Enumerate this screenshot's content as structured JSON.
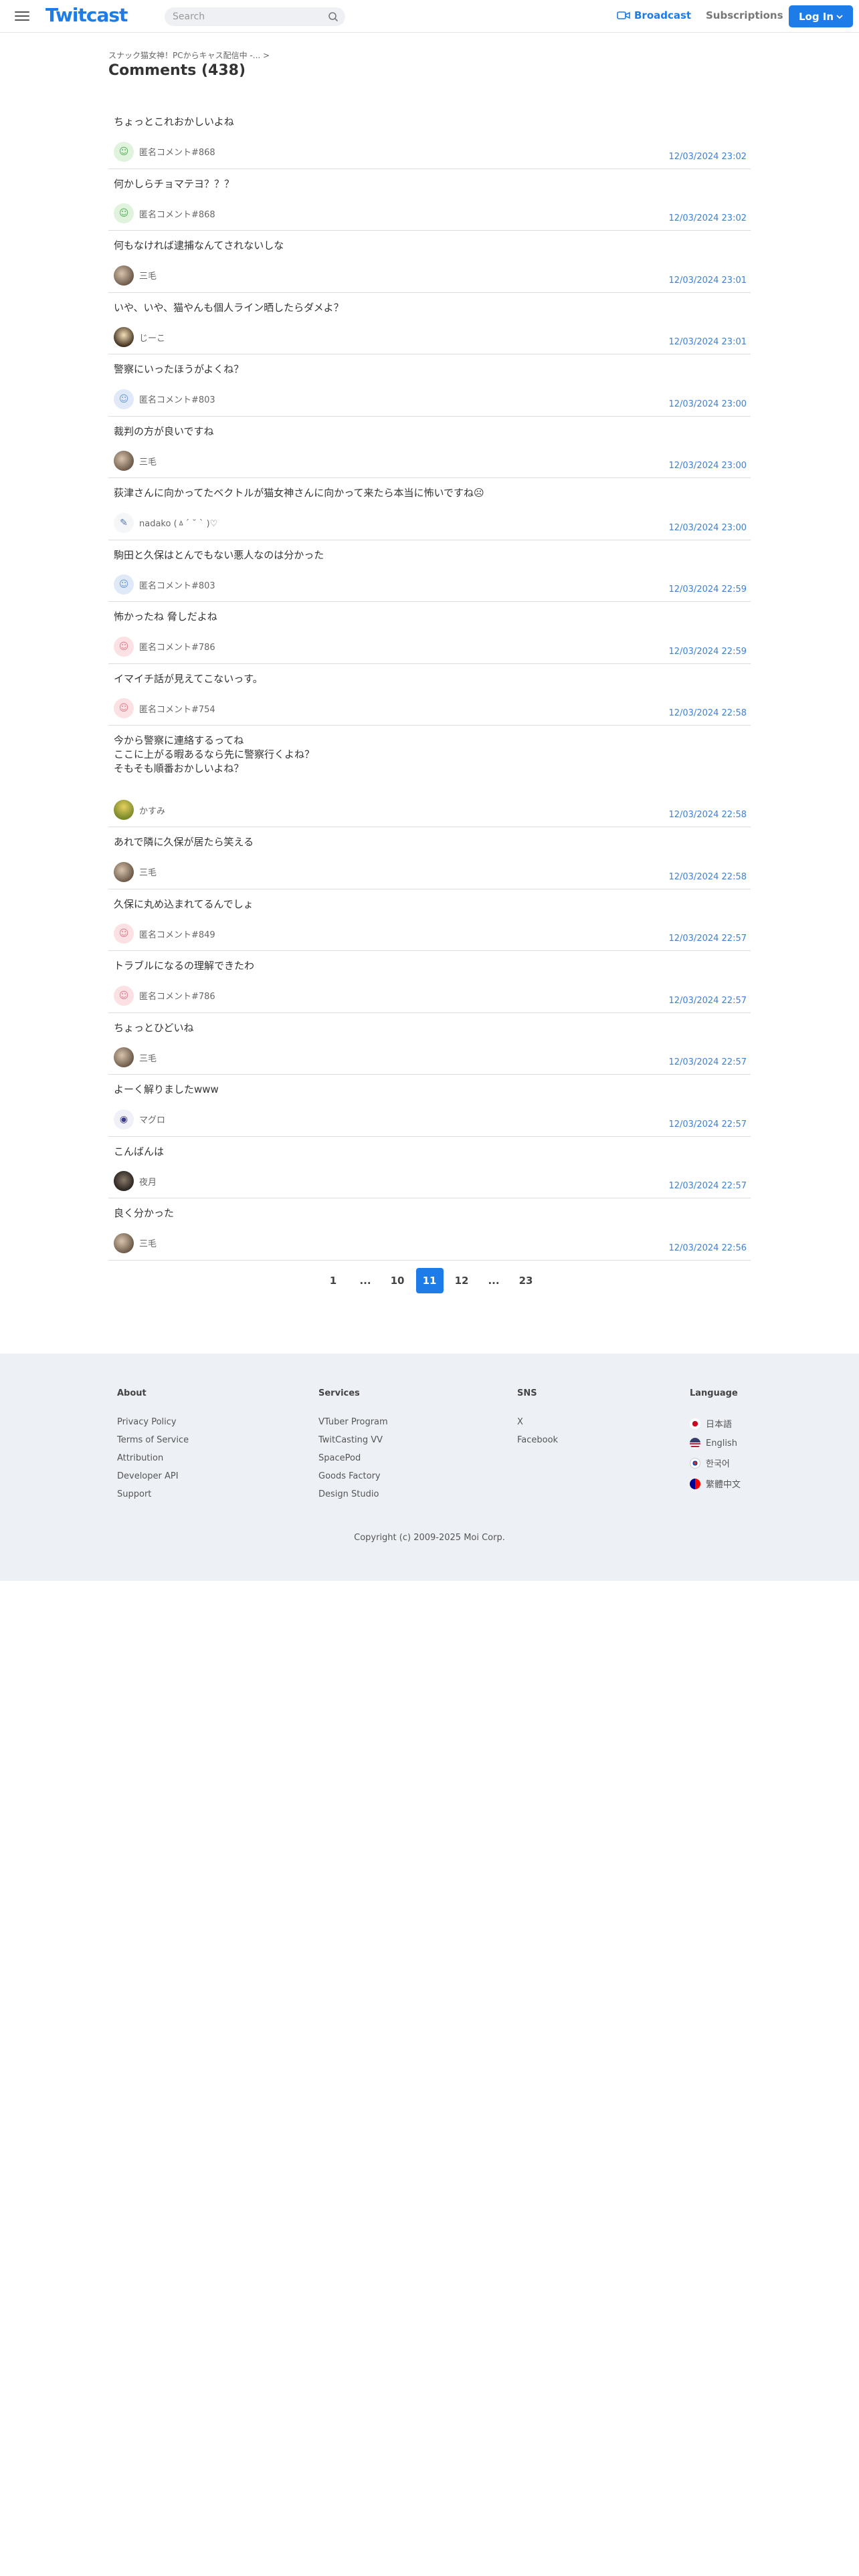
{
  "header": {
    "logo": "Twitcast",
    "search_placeholder": "Search",
    "broadcast_label": "Broadcast",
    "subscriptions_label": "Subscriptions",
    "login_label": "Log In",
    "accent": "#1e7ce8"
  },
  "main": {
    "breadcrumb": "スナック猫女神！PCからキャス配信中 -...",
    "title": "Comments (438)"
  },
  "comments": [
    {
      "text": "ちょっとこれおかしいよね",
      "user": "匿名コメント#868",
      "time": "12/03/2024 23:02",
      "avatar": "green-smile"
    },
    {
      "text": "何かしらチョマテヨ？？？",
      "user": "匿名コメント#868",
      "time": "12/03/2024 23:02",
      "avatar": "green-smile"
    },
    {
      "text": "何もなければ逮捕なんてされないしな",
      "user": "三毛",
      "time": "12/03/2024 23:01",
      "avatar": "cat-photo"
    },
    {
      "text": "いや、いや、猫やんも個人ライン晒したらダメよ？",
      "user": "じーこ",
      "time": "12/03/2024 23:01",
      "avatar": "anime-photo"
    },
    {
      "text": "警察にいったほうがよくね？",
      "user": "匿名コメント#803",
      "time": "12/03/2024 23:00",
      "avatar": "blue-smile"
    },
    {
      "text": "裁判の方が良いですね",
      "user": "三毛",
      "time": "12/03/2024 23:00",
      "avatar": "cat-photo"
    },
    {
      "text": "荻津さんに向かってたベクトルが猫女神さんに向かって来たら本当に怖いですね☹",
      "user": "nadako (ㅿ´ ˘ ` )♡",
      "time": "12/03/2024 23:00",
      "avatar": "sketch"
    },
    {
      "text": "駒田と久保はとんでもない悪人なのは分かった",
      "user": "匿名コメント#803",
      "time": "12/03/2024 22:59",
      "avatar": "blue-smile"
    },
    {
      "text": "怖かったね 脅しだよね",
      "user": "匿名コメント#786",
      "time": "12/03/2024 22:59",
      "avatar": "pink-smile"
    },
    {
      "text": "イマイチ話が見えてこないっす。",
      "user": "匿名コメント#754",
      "time": "12/03/2024 22:58",
      "avatar": "pink-smile"
    },
    {
      "text": "今から警察に連絡するってね\nここに上がる暇あるなら先に警察行くよね？\nそもそも順番おかしいよね？",
      "user": "かすみ",
      "time": "12/03/2024 22:58",
      "avatar": "kasumi"
    },
    {
      "text": "あれで隣に久保が居たら笑える",
      "user": "三毛",
      "time": "12/03/2024 22:58",
      "avatar": "cat-photo"
    },
    {
      "text": "久保に丸め込まれてるんでしょ",
      "user": "匿名コメント#849",
      "time": "12/03/2024 22:57",
      "avatar": "pink-smile"
    },
    {
      "text": "トラブルになるの理解できたわ",
      "user": "匿名コメント#786",
      "time": "12/03/2024 22:57",
      "avatar": "pink-smile"
    },
    {
      "text": "ちょっとひどいね",
      "user": "三毛",
      "time": "12/03/2024 22:57",
      "avatar": "cat-photo"
    },
    {
      "text": "よーく解りましたwww",
      "user": "マグロ",
      "time": "12/03/2024 22:57",
      "avatar": "eye"
    },
    {
      "text": "こんばんは",
      "user": "夜月",
      "time": "12/03/2024 22:57",
      "avatar": "dark-photo"
    },
    {
      "text": "良く分かった",
      "user": "三毛",
      "time": "12/03/2024 22:56",
      "avatar": "cat-photo"
    }
  ],
  "pagination": [
    "1",
    "...",
    "10",
    "11",
    "12",
    "...",
    "23"
  ],
  "pagination_active": "11",
  "footer": {
    "about": {
      "title": "About",
      "links": [
        "Privacy Policy",
        "Terms of Service",
        "Attribution",
        "Developer API",
        "Support"
      ]
    },
    "services": {
      "title": "Services",
      "links": [
        "VTuber Program",
        "TwitCasting VV",
        "SpacePod",
        "Goods Factory",
        "Design Studio"
      ]
    },
    "sns": {
      "title": "SNS",
      "links": [
        "X",
        "Facebook"
      ]
    },
    "language": {
      "title": "Language",
      "links": [
        "日本語",
        "English",
        "한국어",
        "繁體中文"
      ]
    },
    "copyright": "Copyright (c) 2009-2025 Moi Corp."
  }
}
